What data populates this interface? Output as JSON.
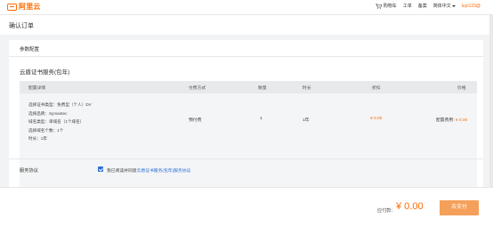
{
  "header": {
    "logo_text": "阿里云",
    "nav": {
      "cart": "购物车",
      "tickets": "工单",
      "filing": "备案",
      "language": "简体中文",
      "user": "luyt123@"
    }
  },
  "page": {
    "title": "确认订单"
  },
  "section": {
    "title": "参数配置"
  },
  "product": {
    "title": "云盾证书服务(包年)"
  },
  "table": {
    "headers": {
      "config": "配置详情",
      "payment": "付费方式",
      "quantity": "数量",
      "duration": "时长",
      "discount": "折扣",
      "price": "价格"
    },
    "config_lines": [
      "选择证书类型：免费型（个人）DV",
      "选择品牌：Symantec",
      "域名类型：单域名（1个域名）",
      "选择域名个数：1个",
      "时长：1年"
    ],
    "row": {
      "payment": "预付费",
      "quantity": "1",
      "duration": "1年",
      "discount": "¥ 0.00",
      "price_label": "配置费用:",
      "price_value": "¥ 0.00"
    }
  },
  "agreement": {
    "label": "服务协议",
    "prefix": "我已阅读并同意",
    "link": "云盾证书服务(包年)服务协议",
    "checked": true
  },
  "footer": {
    "pay_label": "应付款：",
    "pay_amount": "¥ 0.00",
    "pay_button": "去支付"
  },
  "colors": {
    "accent": "#ff6a00",
    "link": "#2f6fd6",
    "button": "#f5a05a"
  }
}
